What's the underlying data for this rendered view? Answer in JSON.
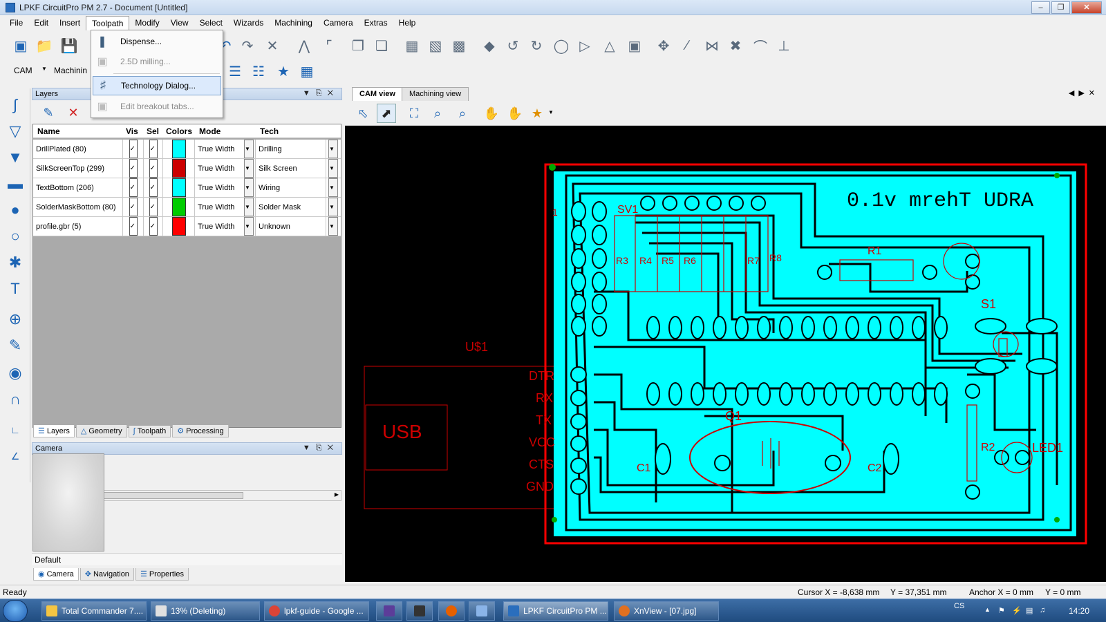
{
  "window": {
    "title": "LPKF CircuitPro PM 2.7 - Document [Untitled]"
  },
  "menu": [
    "File",
    "Edit",
    "Insert",
    "Toolpath",
    "Modify",
    "View",
    "Select",
    "Wizards",
    "Machining",
    "Camera",
    "Extras",
    "Help"
  ],
  "toolbar2": {
    "mode_label": "CAM",
    "machining_label": "Machinin"
  },
  "toolpath_menu": [
    {
      "label": "Dispense...",
      "enabled": true
    },
    {
      "label": "2.5D milling...",
      "enabled": false
    },
    {
      "label": "Technology Dialog...",
      "enabled": true,
      "highlighted": true
    },
    {
      "label": "Edit breakout tabs...",
      "enabled": false
    }
  ],
  "layers_panel": {
    "title": "Layers",
    "columns": [
      "Name",
      "Vis",
      "Sel",
      "Colors",
      "Mode",
      "Tech"
    ],
    "rows": [
      {
        "name": "DrillPlated (80)",
        "vis": true,
        "sel": true,
        "color": "#00ffff",
        "mode": "True Width",
        "tech": "Drilling"
      },
      {
        "name": "SilkScreenTop (299)",
        "vis": true,
        "sel": true,
        "color": "#cc0000",
        "mode": "True Width",
        "tech": "Silk Screen"
      },
      {
        "name": "TextBottom (206)",
        "vis": true,
        "sel": true,
        "color": "#00ffff",
        "mode": "True Width",
        "tech": "Wiring"
      },
      {
        "name": "SolderMaskBottom (80)",
        "vis": true,
        "sel": true,
        "color": "#00cc00",
        "mode": "True Width",
        "tech": "Solder Mask"
      },
      {
        "name": "profile.gbr (5)",
        "vis": true,
        "sel": true,
        "color": "#ff0000",
        "mode": "True Width",
        "tech": "Unknown"
      }
    ],
    "tabs": [
      "Layers",
      "Geometry",
      "Toolpath",
      "Processing"
    ]
  },
  "camera_panel": {
    "title": "Camera",
    "default_label": "Default",
    "tabs": [
      "Camera",
      "Navigation",
      "Properties"
    ]
  },
  "doc_tabs": [
    "CAM view",
    "Machining view"
  ],
  "pcb": {
    "title_text": "0.1v mrehT UDRA",
    "labels": {
      "usb_ref": "U$1",
      "usb": "USB",
      "dtr": "DTR",
      "rx": "RX",
      "tx": "TX",
      "vcc": "VCC",
      "cts": "CTS",
      "gnd": "GND",
      "sv1": "SV1",
      "r1": "R1",
      "r2": "R2",
      "r3": "R3",
      "r4": "R4",
      "r5": "R5",
      "r6": "R6",
      "r7": "R7",
      "r8": "R8",
      "q1": "Q1",
      "c1": "C1",
      "c2": "C2",
      "s1": "S1",
      "led1": "LED1",
      "one": "1"
    },
    "colors": {
      "board": "#00ffff",
      "silk": "#cc0000",
      "profile": "#ff0000",
      "trace": "#000000"
    }
  },
  "status": {
    "ready": "Ready",
    "cursor_x": "Cursor X =   -8,638 mm",
    "cursor_y": "Y =  37,351 mm",
    "anchor_x": "Anchor X =   0 mm",
    "anchor_y": "Y =   0 mm"
  },
  "taskbar": {
    "tasks": [
      "Total Commander 7....",
      "13% (Deleting)",
      "lpkf-guide - Google ...",
      "LPKF CircuitPro PM ...",
      "XnView - [07.jpg]"
    ],
    "lang": "CS",
    "time": "14:20"
  }
}
